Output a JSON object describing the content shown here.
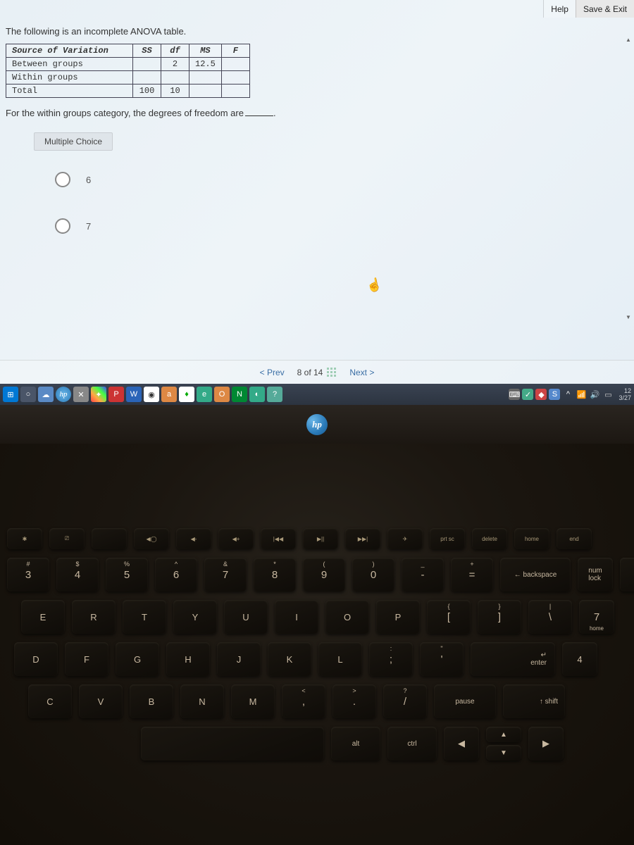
{
  "header": {
    "help": "Help",
    "save_exit": "Save & Exit"
  },
  "question": {
    "intro": "The following is an incomplete ANOVA table.",
    "prompt": "For the within groups category, the degrees of freedom are",
    "table": {
      "headers": {
        "src": "Source of Variation",
        "ss": "SS",
        "df": "df",
        "ms": "MS",
        "f": "F"
      },
      "rows": [
        {
          "src": "Between groups",
          "ss": "",
          "df": "2",
          "ms": "12.5",
          "f": ""
        },
        {
          "src": "Within groups",
          "ss": "",
          "df": "",
          "ms": "",
          "f": ""
        },
        {
          "src": "Total",
          "ss": "100",
          "df": "10",
          "ms": "",
          "f": ""
        }
      ]
    },
    "mc_label": "Multiple Choice",
    "options": [
      "6",
      "7"
    ]
  },
  "nav": {
    "prev": "< Prev",
    "count": "8 of 14",
    "next": "Next >"
  },
  "taskbar": {
    "hp": "hp",
    "clock": {
      "time": "12",
      "date": "3/27"
    }
  },
  "keyboard": {
    "fn": [
      "✱",
      "⎚",
      "",
      "◀◯",
      "◀-",
      "◀+",
      "|◀◀",
      "▶||",
      "▶▶|",
      "✈",
      "prt sc",
      "delete",
      "home",
      "end"
    ],
    "num_row": [
      {
        "t": "#",
        "m": "3"
      },
      {
        "t": "$",
        "m": "4"
      },
      {
        "t": "%",
        "m": "5"
      },
      {
        "t": "^",
        "m": "6"
      },
      {
        "t": "&",
        "m": "7"
      },
      {
        "t": "*",
        "m": "8"
      },
      {
        "t": "(",
        "m": "9"
      },
      {
        "t": ")",
        "m": "0"
      },
      {
        "t": "_",
        "m": "-"
      },
      {
        "t": "+",
        "m": "="
      }
    ],
    "backspace": "← backspace",
    "numlock": "num\nlock",
    "slash": "/",
    "row_qwer": [
      "E",
      "R",
      "T",
      "Y",
      "U",
      "I",
      "O",
      "P"
    ],
    "brackets": [
      {
        "t": "{",
        "m": "["
      },
      {
        "t": "}",
        "m": "]"
      }
    ],
    "pipe": {
      "t": "|",
      "m": "\\"
    },
    "k7home": {
      "m": "7",
      "s": "home"
    },
    "row_asdf": [
      "D",
      "F",
      "G",
      "H",
      "J",
      "K",
      "L"
    ],
    "semi": {
      "t": ":",
      "m": ";"
    },
    "quote": {
      "t": "\"",
      "m": "'"
    },
    "enter": "enter",
    "k4": "4",
    "row_zxcv": [
      "C",
      "V",
      "B",
      "N",
      "M"
    ],
    "comma": {
      "t": "<",
      "m": ","
    },
    "period": {
      "t": ">",
      "m": "."
    },
    "qmark": {
      "t": "?",
      "m": "/"
    },
    "pause": "pause",
    "shift": "↑ shift",
    "bottom": {
      "alt": "alt",
      "ctrl": "ctrl",
      "left": "◀",
      "up": "▲",
      "down": "▼",
      "right": "▶"
    }
  }
}
